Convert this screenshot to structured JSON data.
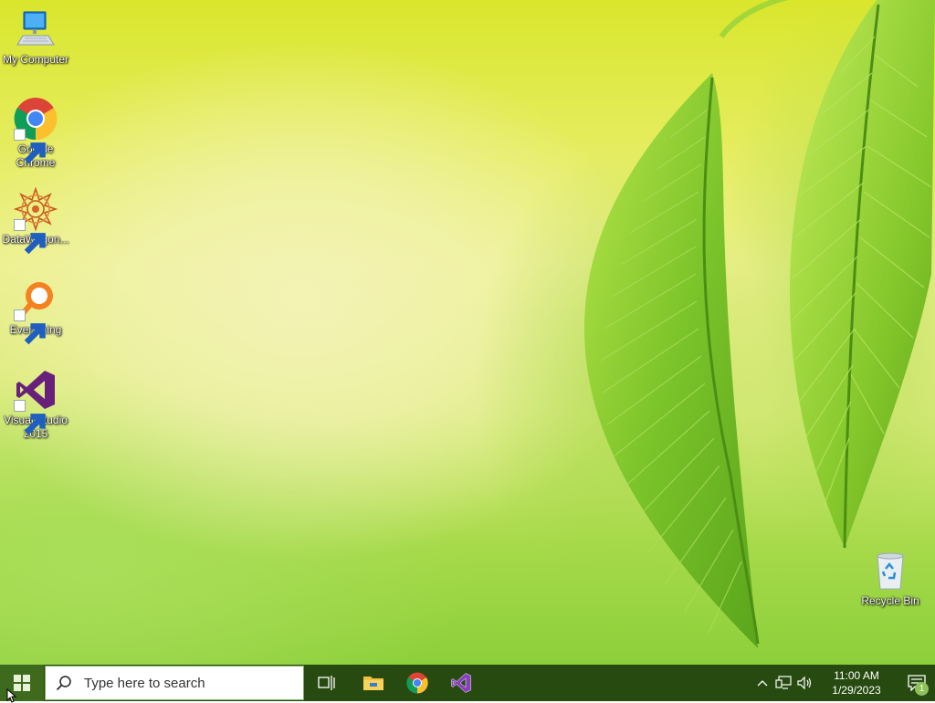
{
  "desktop": {
    "icons": [
      {
        "label": "My Computer",
        "icon": "monitor-icon"
      },
      {
        "label": "Google Chrome",
        "icon": "chrome-icon"
      },
      {
        "label": "DataWagon...",
        "icon": "datawagon-icon"
      },
      {
        "label": "Everything",
        "icon": "everything-search-icon"
      },
      {
        "label": "Visual Studio 2015",
        "icon": "visual-studio-icon"
      }
    ],
    "recycle_bin": {
      "label": "Recycle Bin",
      "icon": "recycle-bin-icon"
    }
  },
  "taskbar": {
    "start_icon": "windows-logo-icon",
    "search": {
      "placeholder": "Type here to search",
      "value": ""
    },
    "pinned": [
      {
        "name": "Task View",
        "icon": "task-view-icon"
      },
      {
        "name": "File Explorer",
        "icon": "folder-icon"
      },
      {
        "name": "Google Chrome",
        "icon": "chrome-icon"
      },
      {
        "name": "Visual Studio",
        "icon": "visual-studio-icon"
      }
    ],
    "tray": {
      "icons": [
        "chevron-up-icon",
        "network-icon",
        "volume-icon"
      ],
      "time": "11:00 AM",
      "date": "1/29/2023",
      "notification_count": "1"
    }
  },
  "colors": {
    "taskbar_bg": "#274a10",
    "accent": "#3d6a1d",
    "desktop_top": "#d9e62c",
    "desktop_bottom": "#8ccf3a"
  }
}
